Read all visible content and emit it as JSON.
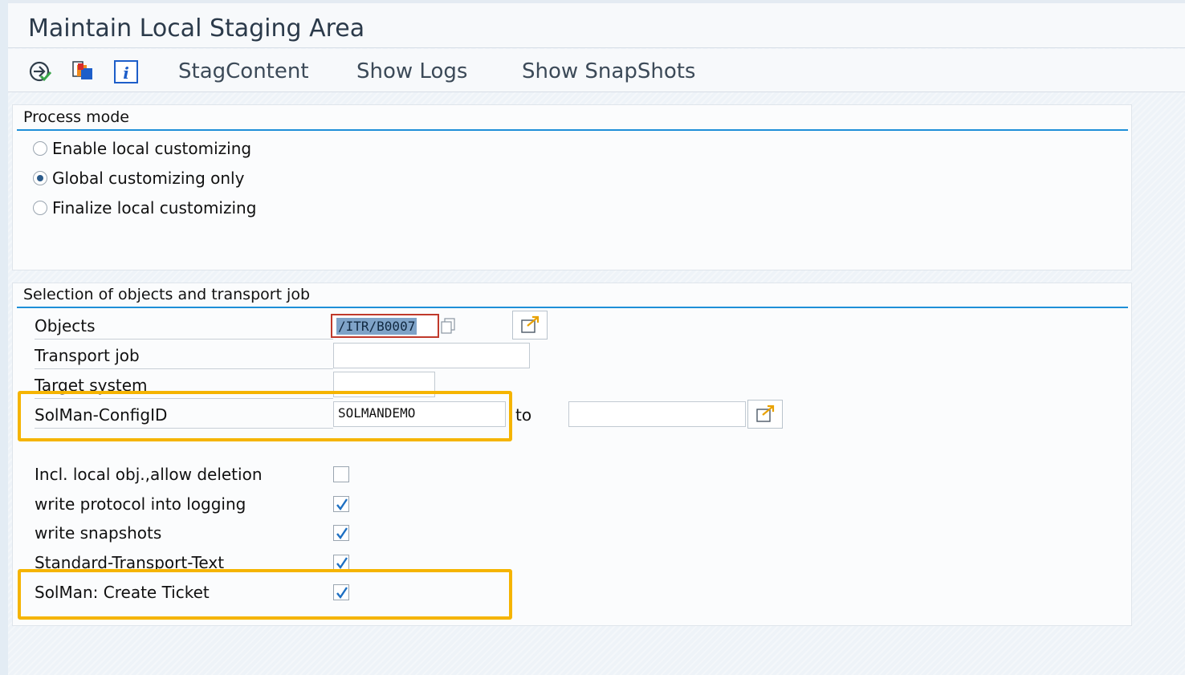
{
  "window": {
    "title": "Maintain Local Staging Area"
  },
  "toolbar": {
    "icons": [
      "execute-icon",
      "copy-objects-icon",
      "info-icon"
    ],
    "buttons": [
      "StagContent",
      "Show Logs",
      "Show SnapShots"
    ]
  },
  "process_mode": {
    "title": "Process mode",
    "options": [
      {
        "label": "Enable local customizing",
        "selected": false
      },
      {
        "label": "Global customizing only",
        "selected": true
      },
      {
        "label": "Finalize local customizing",
        "selected": false
      }
    ]
  },
  "selection": {
    "title": "Selection of objects and transport job",
    "objects": {
      "label": "Objects",
      "value": "/ITR/B0007"
    },
    "transport_job": {
      "label": "Transport job",
      "value": ""
    },
    "target_system": {
      "label": "Target system",
      "value": ""
    },
    "solman_config": {
      "label": "SolMan-ConfigID",
      "value": "SOLMANDEMO",
      "to_label": "to",
      "to_value": ""
    },
    "checkboxes": [
      {
        "label": "Incl. local obj.,allow deletion",
        "checked": false
      },
      {
        "label": "write protocol into logging",
        "checked": true
      },
      {
        "label": "write snapshots",
        "checked": true
      },
      {
        "label": "Standard-Transport-Text",
        "checked": true
      },
      {
        "label": "SolMan: Create Ticket",
        "checked": true
      }
    ]
  },
  "colors": {
    "accent_rule": "#1e8fd8",
    "highlight": "#f5b400",
    "focus_border": "#c0392b"
  }
}
